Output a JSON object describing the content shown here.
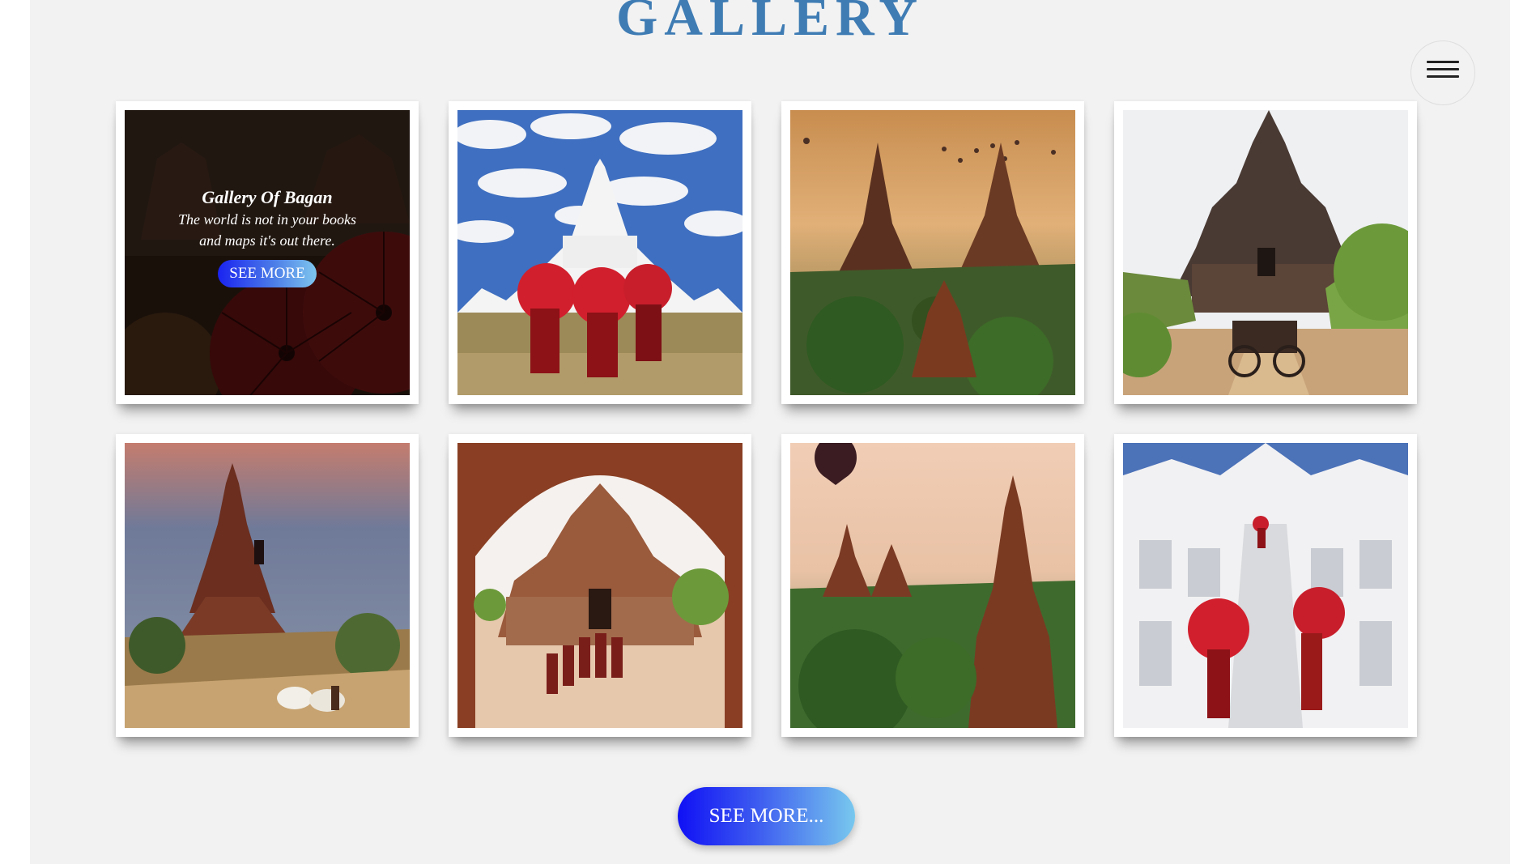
{
  "header": {
    "title": "GALLERY",
    "menu_icon": "hamburger-menu-icon"
  },
  "gallery": {
    "featured": {
      "title": "Gallery Of Bagan",
      "line1": "The world is not in your books",
      "line2": "and maps it's out there.",
      "button_label": "SEE MORE"
    },
    "photos": [
      "umbrella-lanterns",
      "white-pagoda-monks",
      "bagan-sunrise-balloons",
      "temple-horse-cart",
      "temple-ox-cart",
      "temple-arch-monks",
      "balloon-over-temples",
      "white-stupa-monks"
    ]
  },
  "footer": {
    "see_more_label": "SEE MORE..."
  },
  "colors": {
    "title": "#3f7cb4",
    "background": "#f2f2f2",
    "button_start": "#1010f5",
    "button_end": "#78c8ee"
  }
}
